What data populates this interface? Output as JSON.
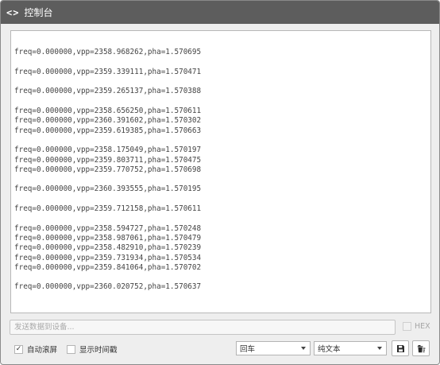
{
  "window": {
    "title_icon": "<>",
    "title": "控制台"
  },
  "console": {
    "lines": [
      "",
      "freq=0.000000,vpp=2358.968262,pha=1.570695",
      "",
      "freq=0.000000,vpp=2359.339111,pha=1.570471",
      "",
      "freq=0.000000,vpp=2359.265137,pha=1.570388",
      "",
      "freq=0.000000,vpp=2358.656250,pha=1.570611",
      "freq=0.000000,vpp=2360.391602,pha=1.570302",
      "freq=0.000000,vpp=2359.619385,pha=1.570663",
      "",
      "freq=0.000000,vpp=2358.175049,pha=1.570197",
      "freq=0.000000,vpp=2359.803711,pha=1.570475",
      "freq=0.000000,vpp=2359.770752,pha=1.570698",
      "",
      "freq=0.000000,vpp=2360.393555,pha=1.570195",
      "",
      "freq=0.000000,vpp=2359.712158,pha=1.570611",
      "",
      "freq=0.000000,vpp=2358.594727,pha=1.570248",
      "freq=0.000000,vpp=2358.987061,pha=1.570479",
      "freq=0.000000,vpp=2358.482910,pha=1.570239",
      "freq=0.000000,vpp=2359.731934,pha=1.570534",
      "freq=0.000000,vpp=2359.841064,pha=1.570702",
      "",
      "freq=0.000000,vpp=2360.020752,pha=1.570637"
    ]
  },
  "send": {
    "placeholder": "发送数据到设备...",
    "value": "",
    "hex_label": "HEX",
    "hex_checked": false
  },
  "options": {
    "auto_scroll_label": "自动滚屏",
    "auto_scroll_checked": true,
    "timestamp_label": "显示时间戳",
    "timestamp_checked": false
  },
  "selects": {
    "line_ending": "回车",
    "encoding": "纯文本"
  },
  "icons": {
    "save": "save-icon",
    "clear": "clear-icon"
  },
  "colors": {
    "titlebar": "#5d5d5d",
    "title_text": "#ffffff",
    "panel_bg": "#eeeeee",
    "console_bg": "#ffffff",
    "console_text": "#444444"
  }
}
